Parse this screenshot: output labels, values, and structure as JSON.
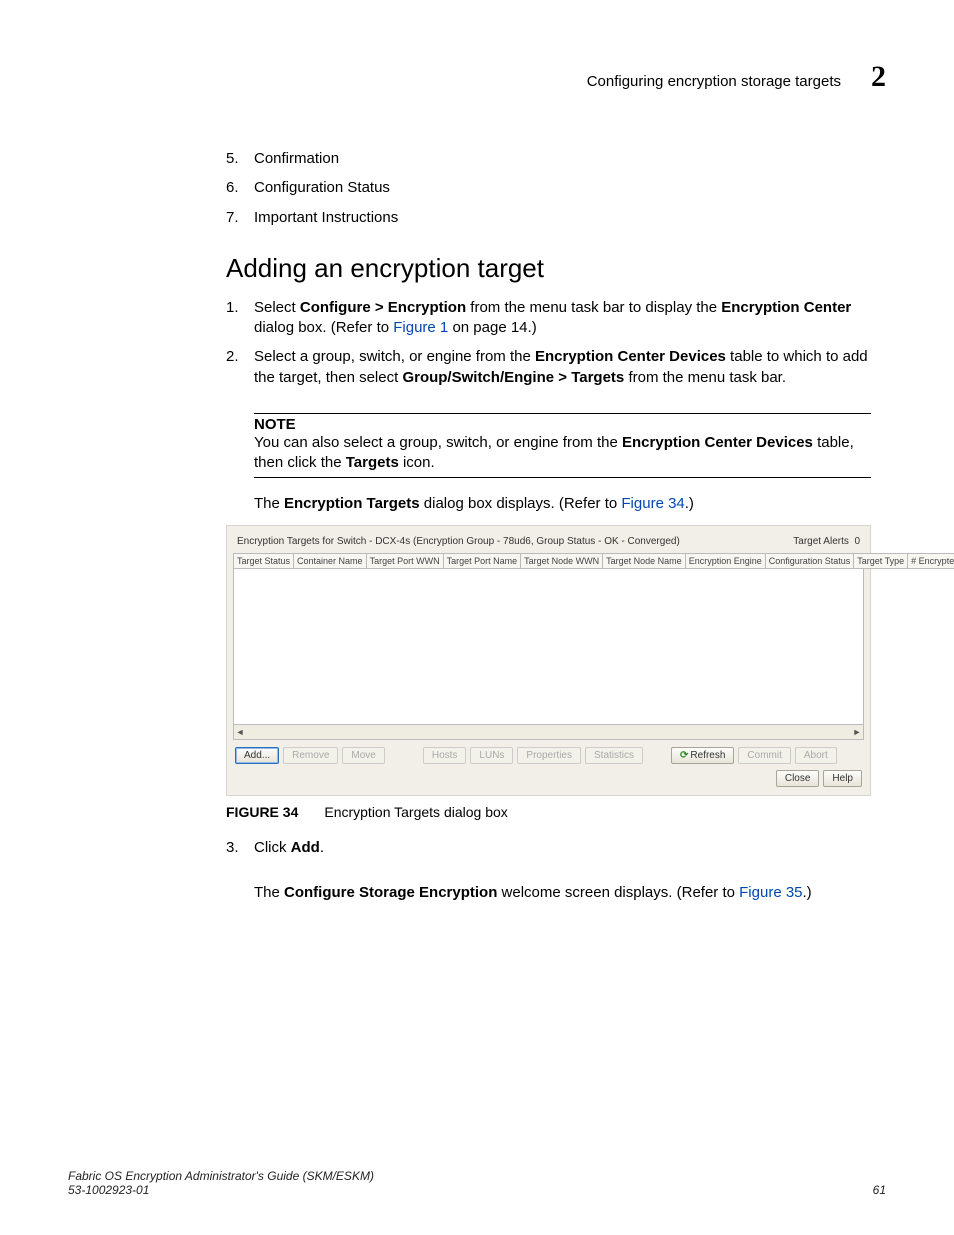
{
  "header": {
    "section": "Configuring encryption storage targets",
    "chapter": "2"
  },
  "initial_list": [
    {
      "n": "5.",
      "text": "Confirmation"
    },
    {
      "n": "6.",
      "text": "Configuration Status"
    },
    {
      "n": "7.",
      "text": "Important Instructions"
    }
  ],
  "heading": "Adding an encryption target",
  "steps12": {
    "s1": {
      "n": "1.",
      "pre": "Select ",
      "b1": "Configure > Encryption",
      "mid": " from the menu task bar to display the ",
      "b2": "Encryption Center",
      "post1": " dialog box. (Refer to ",
      "link": "Figure 1",
      "post2": " on page 14.)"
    },
    "s2": {
      "n": "2.",
      "pre": "Select a group, switch, or engine from the ",
      "b1": "Encryption Center Devices",
      "mid1": " table to which to add the target, then select ",
      "b2": "Group/Switch/Engine > Targets",
      "post": " from the menu task bar."
    }
  },
  "note": {
    "label": "NOTE",
    "t1": "You can also select a group, switch, or engine from the ",
    "b1": "Encryption Center Devices",
    "t2": " table, then click the ",
    "b2": "Targets",
    "t3": " icon."
  },
  "para_targets": {
    "t1": "The ",
    "b1": "Encryption Targets",
    "t2": " dialog box displays. (Refer to ",
    "link": "Figure 34",
    "t3": ".)"
  },
  "dialog": {
    "title": "Encryption Targets for Switch - DCX-4s (Encryption Group - 78ud6, Group Status - OK - Converged)",
    "alerts_label": "Target Alerts",
    "alerts_count": "0",
    "cols": [
      "Target Status",
      "Container Name",
      "Target Port WWN",
      "Target Port Name",
      "Target Node WWN",
      "Target Node Name",
      "Encryption Engine",
      "Configuration Status",
      "Target Type",
      "# Encrypted / #"
    ],
    "buttons": {
      "add": "Add...",
      "remove": "Remove",
      "move": "Move",
      "hosts": "Hosts",
      "luns": "LUNs",
      "properties": "Properties",
      "statistics": "Statistics",
      "refresh": "Refresh",
      "commit": "Commit",
      "abort": "Abort",
      "close": "Close",
      "help": "Help"
    }
  },
  "figcap": {
    "label": "FIGURE 34",
    "text": "Encryption Targets dialog box"
  },
  "step3": {
    "n": "3.",
    "t1": "Click ",
    "b1": "Add",
    "t2": "."
  },
  "step3_para": {
    "t1": "The ",
    "b1": "Configure Storage Encryption",
    "t2": " welcome screen displays. (Refer to ",
    "link": "Figure 35",
    "t3": ".)"
  },
  "footer": {
    "title": "Fabric OS Encryption Administrator's Guide (SKM/ESKM)",
    "docnum": "53-1002923-01",
    "page": "61"
  }
}
